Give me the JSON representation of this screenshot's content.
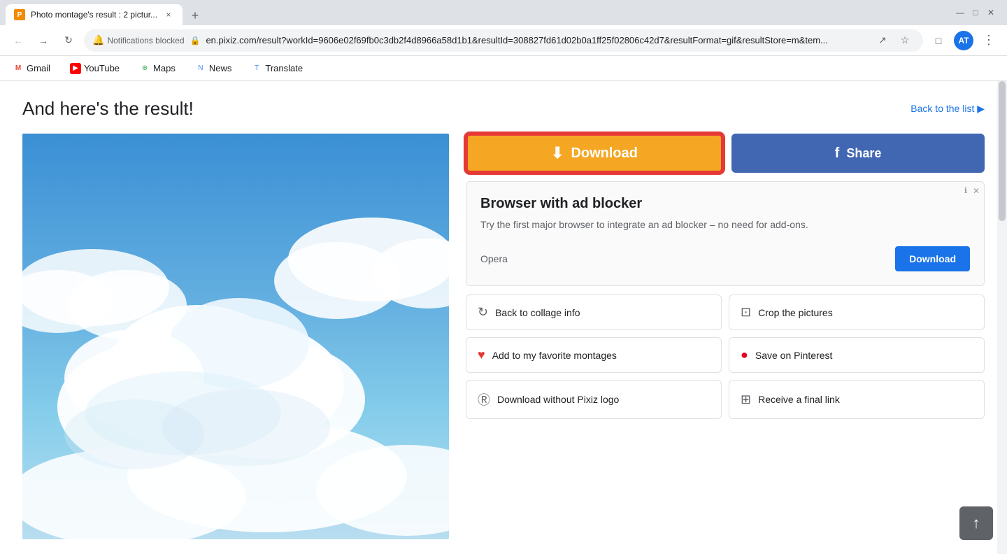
{
  "browser": {
    "tab": {
      "favicon_letter": "P",
      "title": "Photo montage's result : 2 pictur...",
      "close_label": "×"
    },
    "tab_new_label": "+",
    "window_controls": {
      "minimize": "—",
      "maximize": "□",
      "close": "✕"
    },
    "address_bar": {
      "notifications_blocked": "Notifications blocked",
      "lock_icon": "🔒",
      "url": "en.pixiz.com/result?workId=9606e02f69fb0c3db2f4d8966a58d1b1&resultId=308827fd61d02b0a1ff25f02806c42d7&resultFormat=gif&resultStore=m&tem...",
      "share_icon": "↗",
      "star_icon": "☆",
      "avatar_letters": "AT"
    },
    "bookmarks": [
      {
        "label": "Gmail",
        "icon": "M",
        "color": "#ea4335"
      },
      {
        "label": "YouTube",
        "icon": "▶",
        "color": "#ff0000"
      },
      {
        "label": "Maps",
        "icon": "⊕",
        "color": "#34a853"
      },
      {
        "label": "News",
        "icon": "N",
        "color": "#4285f4"
      },
      {
        "label": "Translate",
        "icon": "T",
        "color": "#4285f4"
      }
    ]
  },
  "page": {
    "title": "And here's the result!",
    "back_to_list": "Back to the list ▶"
  },
  "download_button": {
    "label": "Download",
    "icon": "⬇"
  },
  "share_button": {
    "label": "Share",
    "facebook_icon": "f"
  },
  "ad": {
    "title": "Browser with ad blocker",
    "description": "Try the first major browser to integrate an ad blocker – no need for add-ons.",
    "brand": "Opera",
    "cta_label": "Download",
    "info_icon": "ℹ",
    "close_icon": "✕"
  },
  "action_buttons": [
    {
      "icon": "↻",
      "label": "Back to collage info",
      "icon_type": "default"
    },
    {
      "icon": "⊡",
      "label": "Crop the pictures",
      "icon_type": "default"
    },
    {
      "icon": "♥",
      "label": "Add to my favorite montages",
      "icon_type": "red"
    },
    {
      "icon": "●",
      "label": "Save on Pinterest",
      "icon_type": "pinterest"
    },
    {
      "icon": "Ⓡ",
      "label": "Download without Pixiz logo",
      "icon_type": "default"
    },
    {
      "icon": "⊞",
      "label": "Receive a final link",
      "icon_type": "default"
    }
  ],
  "scroll_to_top": "↑"
}
